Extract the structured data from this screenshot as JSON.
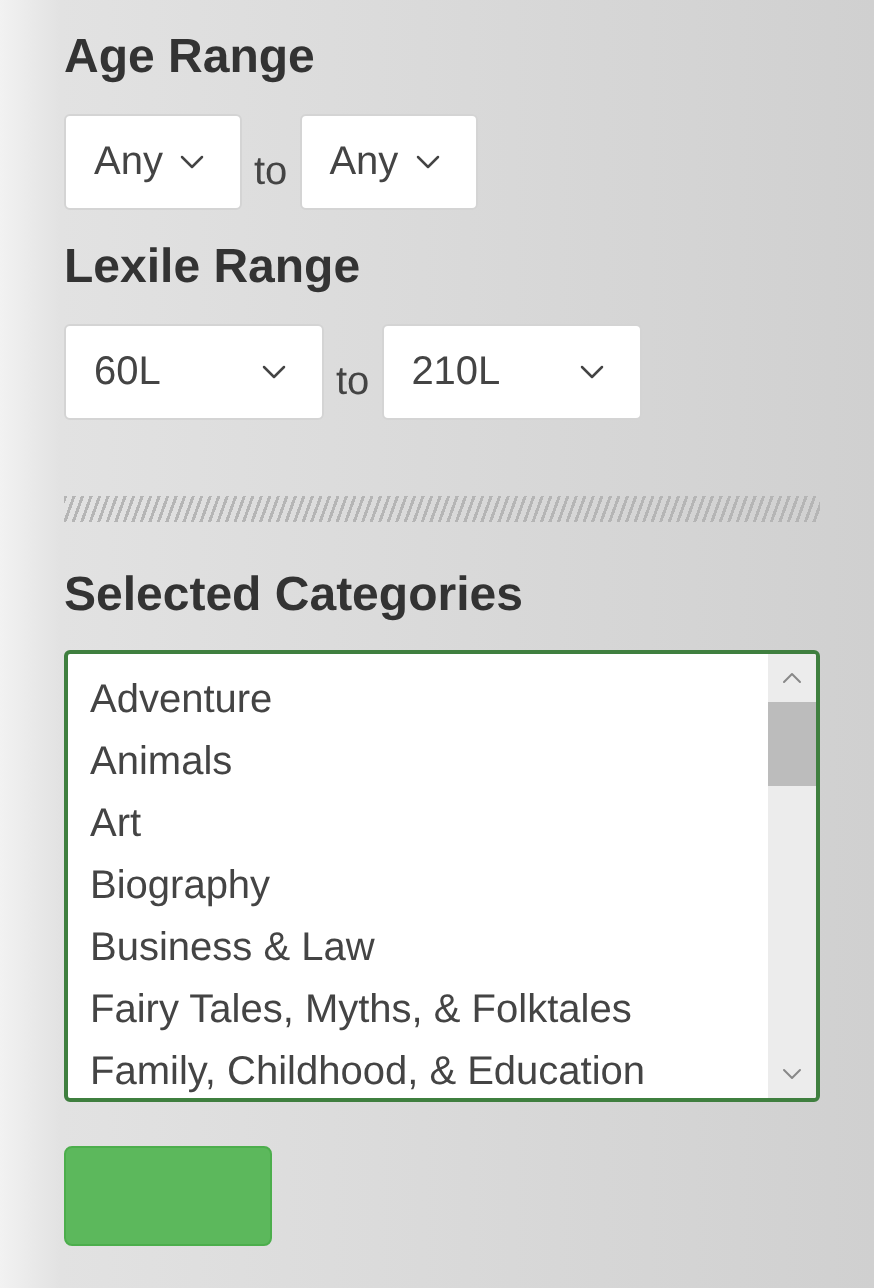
{
  "age_range": {
    "title": "Age Range",
    "from": {
      "value": "Any"
    },
    "separator": "to",
    "to": {
      "value": "Any"
    }
  },
  "lexile_range": {
    "title": "Lexile Range",
    "from": {
      "value": "60L"
    },
    "separator": "to",
    "to": {
      "value": "210L"
    }
  },
  "selected_categories": {
    "title": "Selected Categories",
    "items": [
      "Adventure",
      "Animals",
      "Art",
      "Biography",
      "Business & Law",
      "Fairy Tales, Myths, & Folktales",
      "Family, Childhood, & Education"
    ]
  }
}
